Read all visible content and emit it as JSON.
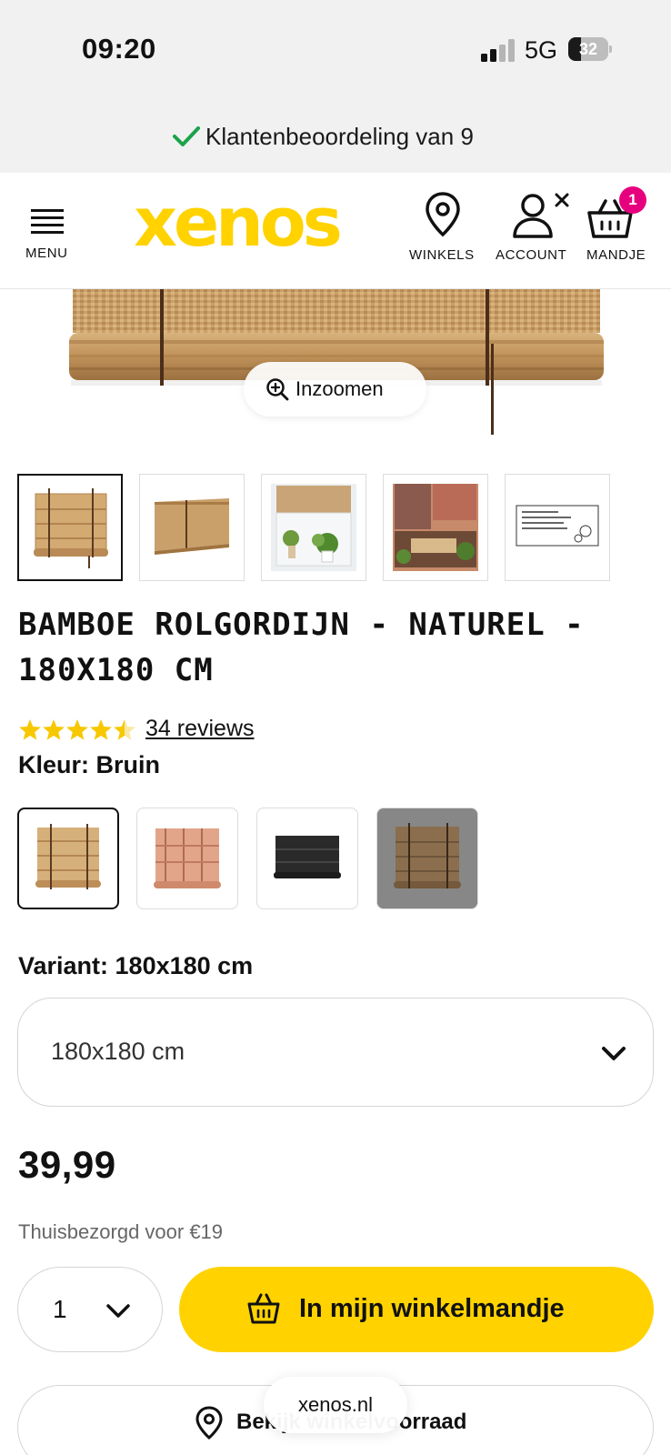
{
  "status_bar": {
    "time": "09:20",
    "network": "5G",
    "battery": "32",
    "battery_level": 0.32
  },
  "usp": {
    "text": "Klantenbeoordeling van 9"
  },
  "header": {
    "menu_label": "MENU",
    "logo_text": "xenos",
    "stores_label": "WINKELS",
    "account_label": "ACCOUNT",
    "cart_label": "MANDJE",
    "cart_count": "1",
    "brand_color": "#ffd200",
    "badge_color": "#e6007e"
  },
  "gallery": {
    "zoom_label": "Inzoomen",
    "thumbnails": [
      "blind-front",
      "blind-angle",
      "blind-window-plants",
      "blind-terrace",
      "instruction-sheet"
    ],
    "active_index": 0
  },
  "product": {
    "title": "BAMBOE ROLGORDIJN - NATUREL - 180X180 CM",
    "rating": 4.5,
    "rating_max": 5,
    "reviews_link": "34 reviews",
    "color_label": "Kleur: Bruin",
    "swatches": [
      "naturel",
      "rood",
      "zwart",
      "bruin"
    ],
    "active_swatch": 0,
    "variant_label": "Variant: 180x180 cm",
    "variant_value": "180x180 cm",
    "price": "39,99",
    "delivery": "Thuisbezorgd voor €19"
  },
  "actions": {
    "quantity": "1",
    "add_to_cart": "In mijn winkelmandje",
    "stock_check": "Bekijk winkelvoorraad"
  },
  "browser": {
    "url": "xenos.nl"
  }
}
